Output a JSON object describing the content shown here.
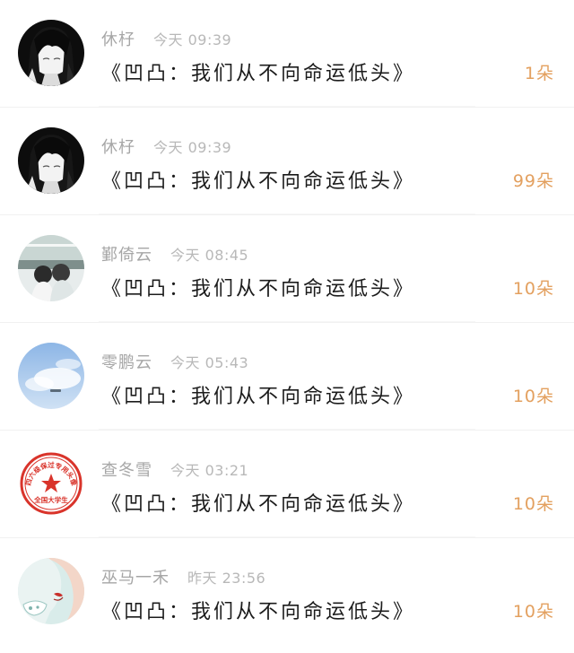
{
  "gifts": [
    {
      "name": "休杍",
      "time": "今天 09:39",
      "gift": "《凹凸：我们从不向命运低头》",
      "count": "1朵",
      "avatar_icon": "anime-girl-dark-avatar"
    },
    {
      "name": "休杍",
      "time": "今天 09:39",
      "gift": "《凹凸：我们从不向命运低头》",
      "count": "99朵",
      "avatar_icon": "anime-girl-dark-avatar"
    },
    {
      "name": "鄞倚云",
      "time": "今天 08:45",
      "gift": "《凹凸：我们从不向命运低头》",
      "count": "10朵",
      "avatar_icon": "couple-photo-avatar"
    },
    {
      "name": "零鹏云",
      "time": "今天 05:43",
      "gift": "《凹凸：我们从不向命运低头》",
      "count": "10朵",
      "avatar_icon": "sky-clouds-avatar"
    },
    {
      "name": "查冬雪",
      "time": "今天 03:21",
      "gift": "《凹凸：我们从不向命运低头》",
      "count": "10朵",
      "avatar_icon": "red-star-seal-avatar"
    },
    {
      "name": "巫马一禾",
      "time": "昨天 23:56",
      "gift": "《凹凸：我们从不向命运低头》",
      "count": "10朵",
      "avatar_icon": "illustrated-face-avatar"
    }
  ],
  "colors": {
    "count": "#e3a05f",
    "name": "#a6a6a6",
    "time": "#b8b8b8",
    "text": "#1c1c1c",
    "seal_red": "#d9342b"
  },
  "seal": {
    "arc_text": "四六级保过专用头像",
    "bottom_text": "全国大学生"
  }
}
